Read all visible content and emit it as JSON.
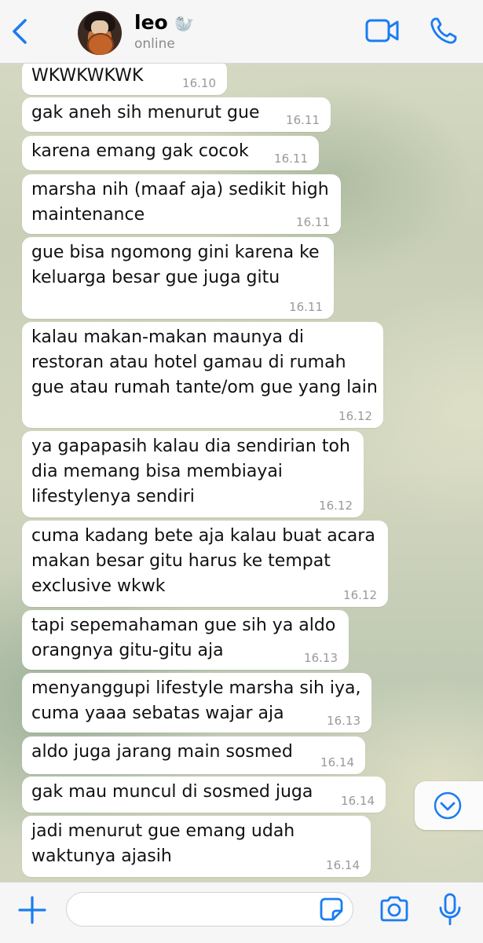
{
  "header": {
    "contact_name": "leo",
    "contact_emoji": "🦭",
    "status": "online",
    "back_icon": "chevron-left-icon",
    "video_icon": "video-camera-icon",
    "call_icon": "phone-icon"
  },
  "colors": {
    "accent": "#1a7cf2",
    "bubble": "#ffffff",
    "header": "#f6f6f6"
  },
  "messages": [
    {
      "text": "WKWKWKWK",
      "time": "16.10"
    },
    {
      "text": "gak aneh sih menurut gue",
      "time": "16.11"
    },
    {
      "text": "karena emang gak cocok",
      "time": "16.11"
    },
    {
      "text": "marsha nih (maaf aja) sedikit high\nmaintenance",
      "time": "16.11"
    },
    {
      "text": "gue bisa ngomong gini karena ke\nkeluarga besar gue juga gitu",
      "time": "16.11"
    },
    {
      "text": "kalau makan-makan maunya di\nrestoran atau hotel gamau di rumah\ngue atau rumah tante/om gue yang lain",
      "time": "16.12"
    },
    {
      "text": "ya gapapasih kalau dia sendirian toh\ndia memang bisa membiayai\nlifestylenya sendiri",
      "time": "16.12"
    },
    {
      "text": "cuma kadang bete aja kalau buat acara\nmakan besar gitu harus ke tempat\nexclusive wkwk",
      "time": "16.12"
    },
    {
      "text": "tapi sepemahaman gue sih ya aldo\norangnya gitu-gitu aja",
      "time": "16.13"
    },
    {
      "text": "menyanggupi lifestyle marsha sih iya,\ncuma yaaa sebatas wajar aja",
      "time": "16.13"
    },
    {
      "text": "aldo juga jarang main sosmed",
      "time": "16.14"
    },
    {
      "text": "gak mau muncul di sosmed juga",
      "time": "16.14"
    },
    {
      "text": "jadi menurut gue emang udah\nwaktunya ajasih",
      "time": "16.14"
    }
  ],
  "input": {
    "value": "",
    "placeholder": ""
  },
  "toolbar": {
    "plus_icon": "plus-icon",
    "sticker_icon": "sticker-icon",
    "camera_icon": "camera-icon",
    "mic_icon": "microphone-icon",
    "scroll_icon": "chevron-down-circle-icon"
  }
}
